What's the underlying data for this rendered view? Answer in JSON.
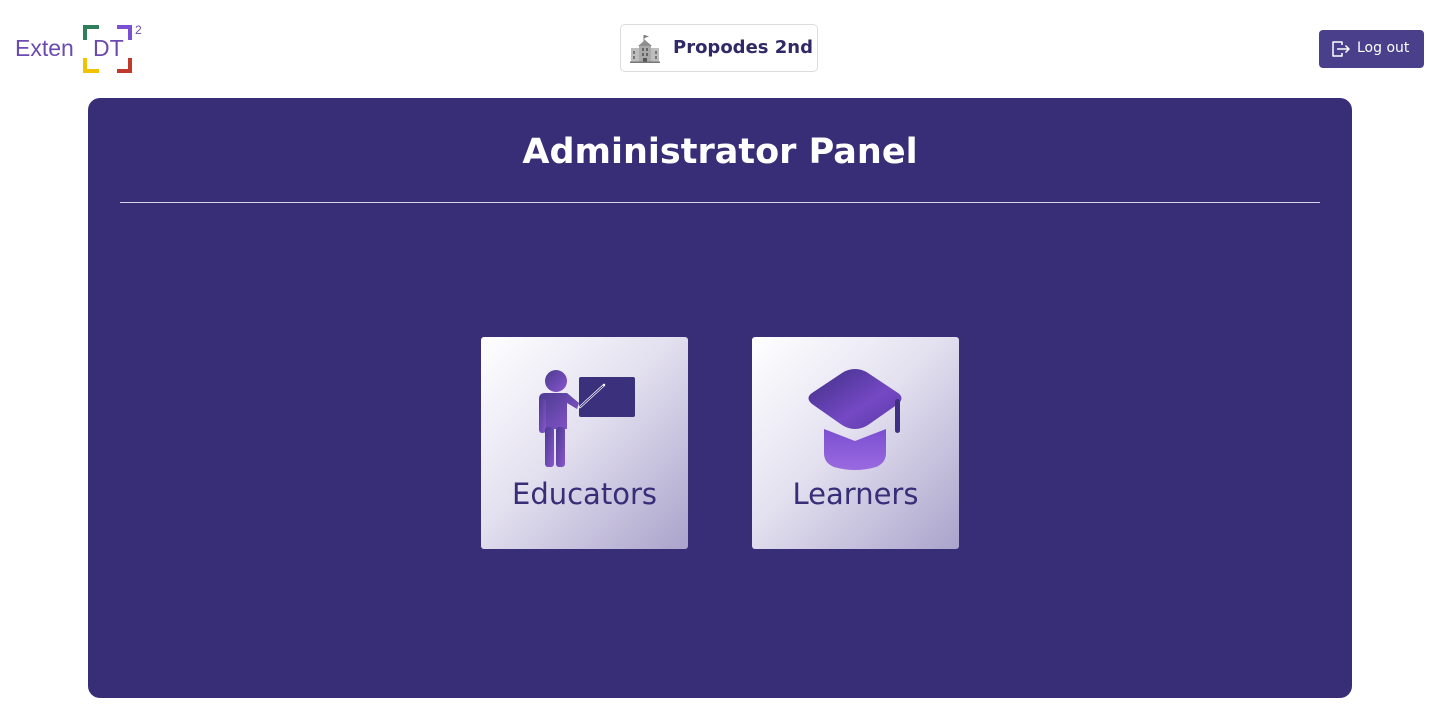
{
  "header": {
    "logo": {
      "text_left": "Exten",
      "text_right": "DT",
      "superscript": "2",
      "frame_colors": [
        "#2e7d5b",
        "#7b4fd1",
        "#f2c200",
        "#c0392b"
      ]
    },
    "school": {
      "icon": "school-building-icon",
      "name": "Propodes 2nd"
    },
    "logout": {
      "icon": "logout-icon",
      "label": "Log out"
    }
  },
  "panel": {
    "title": "Administrator Panel",
    "cards": [
      {
        "icon": "teacher-icon",
        "label": "Educators"
      },
      {
        "icon": "graduation-cap-icon",
        "label": "Learners"
      }
    ]
  },
  "colors": {
    "panel_bg": "#372e77",
    "accent": "#4a3f8a",
    "logo_purple": "#6b4bb0",
    "icon_purple": "#7b4fc9"
  }
}
